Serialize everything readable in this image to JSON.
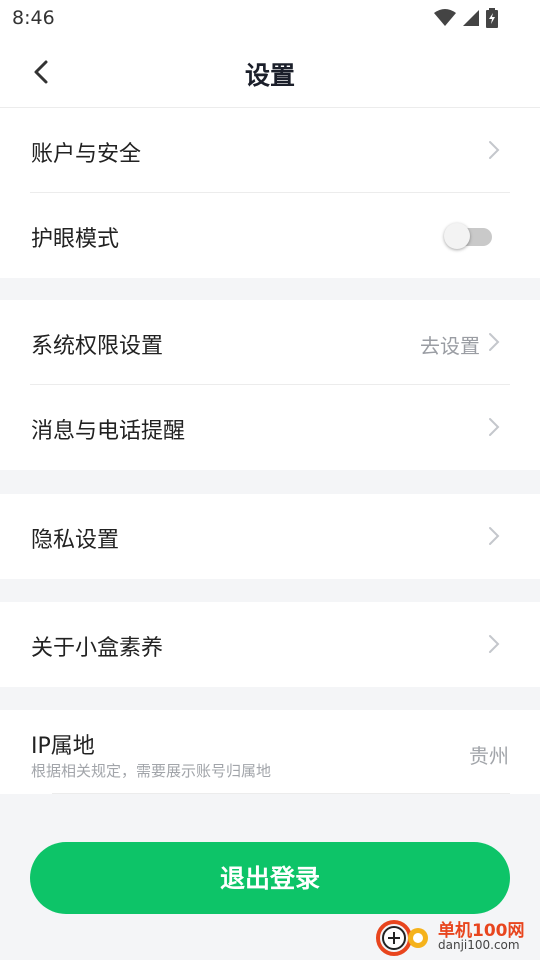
{
  "status_bar": {
    "time": "8:46"
  },
  "header": {
    "title": "设置"
  },
  "groups": [
    {
      "items": [
        {
          "label": "账户与安全"
        },
        {
          "label": "护眼模式",
          "toggle_on": false
        }
      ]
    },
    {
      "items": [
        {
          "label": "系统权限设置",
          "value": "去设置"
        },
        {
          "label": "消息与电话提醒"
        }
      ]
    },
    {
      "items": [
        {
          "label": "隐私设置"
        }
      ]
    },
    {
      "items": [
        {
          "label": "关于小盒素养"
        }
      ]
    },
    {
      "items": [
        {
          "label": "IP属地",
          "sublabel": "根据相关规定，需要展示账号归属地",
          "value": "贵州"
        }
      ]
    }
  ],
  "logout_label": "退出登录",
  "watermark": {
    "line1": "单机100网",
    "line2": "danji100.com"
  },
  "colors": {
    "accent": "#0dc468",
    "background": "#f4f5f7"
  }
}
